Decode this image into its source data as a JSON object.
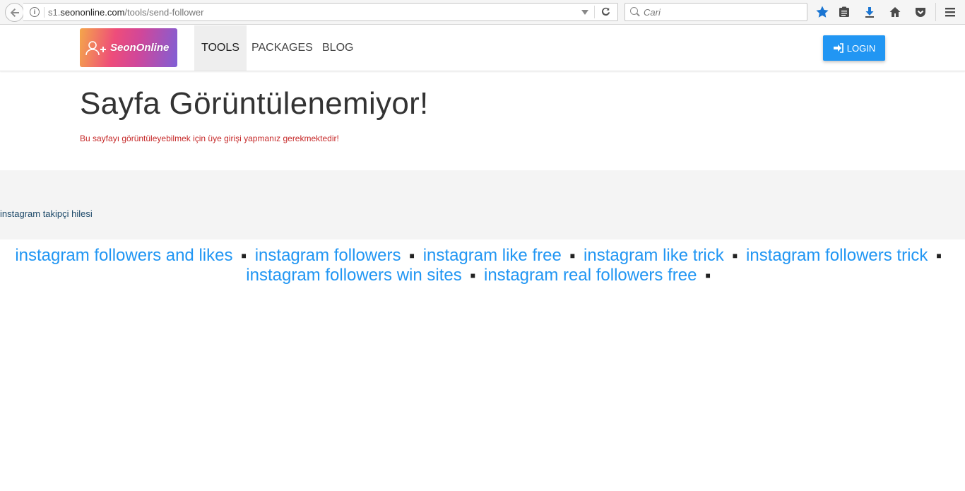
{
  "browser": {
    "url_host": "s1.seononline.com",
    "url_prefix": "s1.",
    "url_domain": "seononline.com",
    "url_path": "/tools/send-follower",
    "search_placeholder": "Cari"
  },
  "header": {
    "logo_text": "SeonOnline",
    "nav": [
      {
        "label": "TOOLS",
        "active": true
      },
      {
        "label": "PACKAGES",
        "active": false
      },
      {
        "label": "BLOG",
        "active": false
      }
    ],
    "login_label": "LOGIN"
  },
  "main": {
    "title": "Sayfa Görüntülenemiyor!",
    "message": "Bu sayfayı görüntüleyebilmek için üye girişi yapmanız gerekmektedir!"
  },
  "band": {
    "link_text": "instagram takipçi hilesi"
  },
  "tags": [
    "instagram followers and likes",
    "instagram followers",
    "instagram like free",
    "instagram like trick",
    "instagram followers trick",
    "instagram followers win sites",
    "instagram real followers free"
  ],
  "tag_separator": "■"
}
